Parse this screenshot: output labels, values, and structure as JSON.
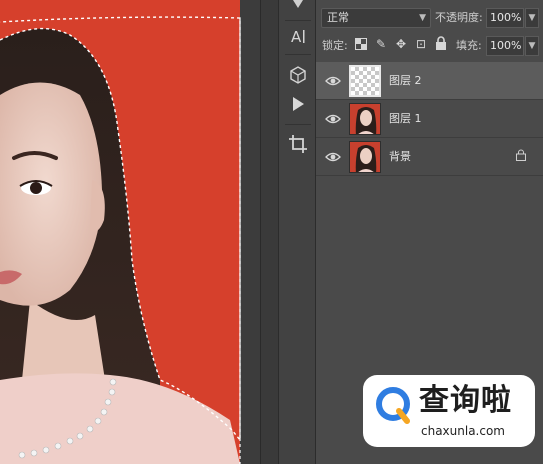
{
  "layers_panel": {
    "blend_mode": "正常",
    "opacity_label": "不透明度:",
    "opacity_value": "100%",
    "lock_label": "锁定:",
    "fill_label": "填充:",
    "fill_value": "100%",
    "layers": [
      {
        "name": "图层 2",
        "selected": true,
        "visible": true,
        "thumbnail": "transparent-checker",
        "locked": false
      },
      {
        "name": "图层 1",
        "selected": false,
        "visible": true,
        "thumbnail": "portrait",
        "locked": false
      },
      {
        "name": "背景",
        "selected": false,
        "visible": true,
        "thumbnail": "portrait",
        "locked": true
      }
    ]
  },
  "toolbar": {
    "icons": [
      "paragraph-text-icon",
      "3d-cube-icon",
      "play-icon",
      "crop-icon"
    ]
  },
  "canvas": {
    "background_color": "#d6402c",
    "content": "portrait with marching-ants selection around subject"
  },
  "watermark": {
    "brand": "查询啦",
    "domain": "chaxunla.com",
    "accent": "#2f7de1",
    "accent2": "#f5a623"
  }
}
